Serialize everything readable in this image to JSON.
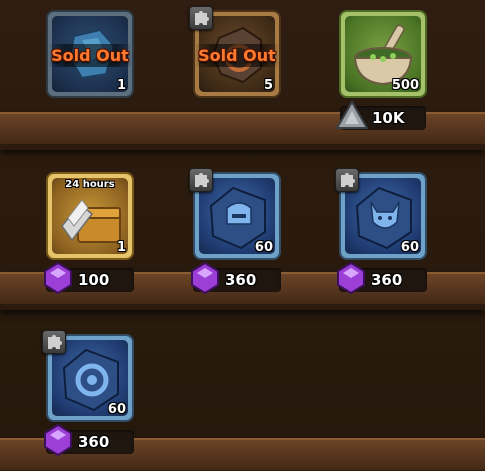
{
  "shop": {
    "items": [
      {
        "name": "shard-item",
        "status_label": "Sold Out",
        "quantity": "1"
      },
      {
        "name": "ore-item",
        "status_label": "Sold Out",
        "quantity": "5"
      },
      {
        "name": "mortar-item",
        "quantity": "500",
        "price": "10K",
        "currency_icon": "triangle-stone-icon"
      },
      {
        "name": "chest-item",
        "timer_label": "24 hours",
        "quantity": "1",
        "price": "100",
        "currency_icon": "gem-icon"
      },
      {
        "name": "rune-helmet-item",
        "quantity": "60",
        "price": "360",
        "currency_icon": "gem-icon"
      },
      {
        "name": "rune-wolf-item",
        "quantity": "60",
        "price": "360",
        "currency_icon": "gem-icon"
      },
      {
        "name": "rune-wheel-item",
        "quantity": "60",
        "price": "360",
        "currency_icon": "gem-icon"
      }
    ]
  },
  "colors": {
    "sold_out": "#ff7a2e",
    "gem": "#9b3fd6",
    "shelf": "#5a3820"
  }
}
